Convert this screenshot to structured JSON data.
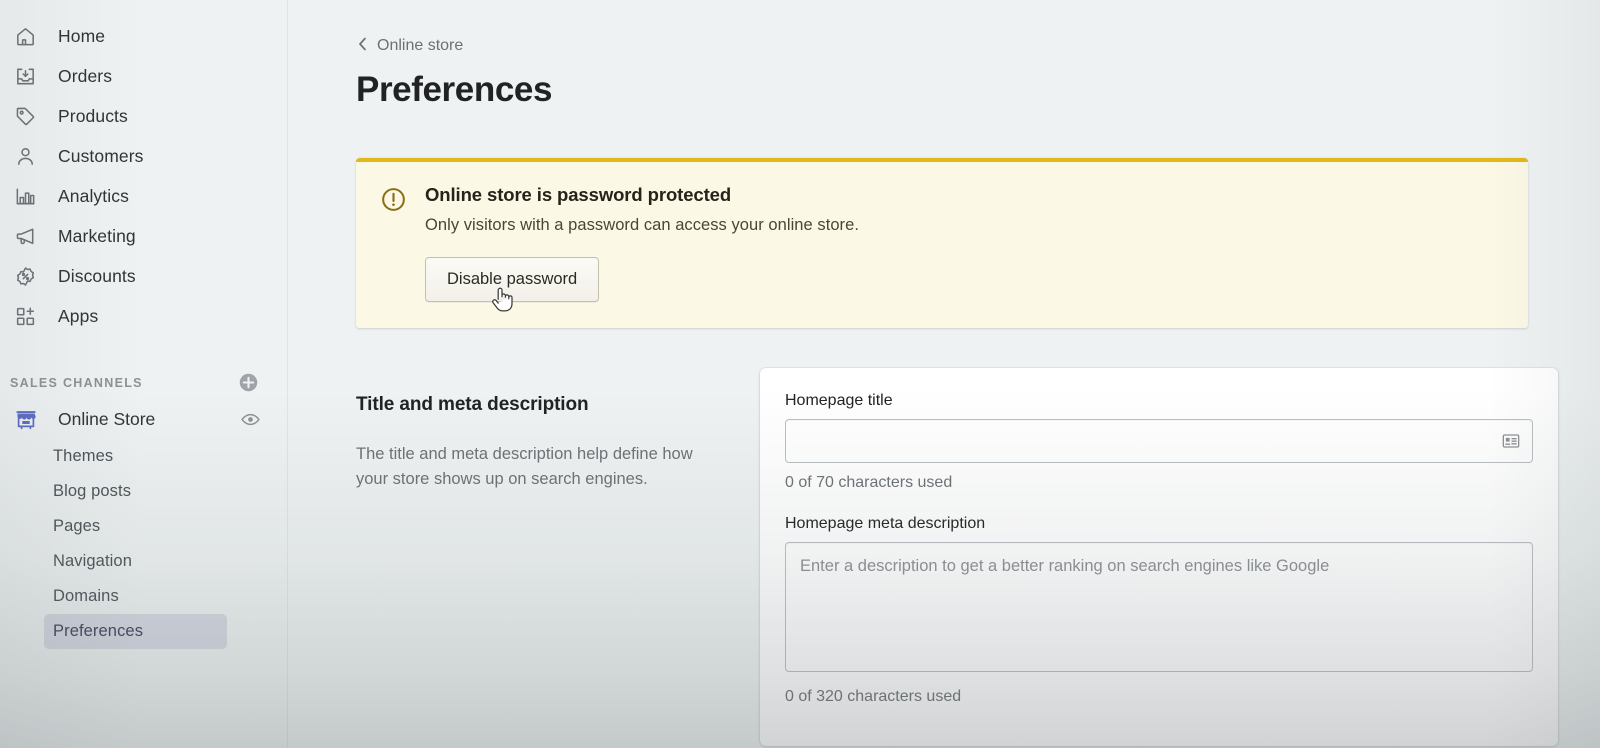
{
  "sidebar": {
    "nav_items": [
      {
        "label": "Home",
        "icon": "home-icon"
      },
      {
        "label": "Orders",
        "icon": "orders-inbox-icon"
      },
      {
        "label": "Products",
        "icon": "product-tag-icon"
      },
      {
        "label": "Customers",
        "icon": "customer-person-icon"
      },
      {
        "label": "Analytics",
        "icon": "analytics-bar-chart-icon"
      },
      {
        "label": "Marketing",
        "icon": "marketing-megaphone-icon"
      },
      {
        "label": "Discounts",
        "icon": "discount-percent-icon"
      },
      {
        "label": "Apps",
        "icon": "apps-grid-plus-icon"
      }
    ],
    "section": {
      "title": "Sales Channels",
      "add_icon": "add-circle-icon"
    },
    "channel": {
      "label": "Online Store",
      "icon": "online-store-icon",
      "view_icon": "eye-icon"
    },
    "sub_items": [
      {
        "label": "Themes",
        "selected": false
      },
      {
        "label": "Blog posts",
        "selected": false
      },
      {
        "label": "Pages",
        "selected": false
      },
      {
        "label": "Navigation",
        "selected": false
      },
      {
        "label": "Domains",
        "selected": false
      },
      {
        "label": "Preferences",
        "selected": true
      }
    ]
  },
  "main": {
    "breadcrumb": {
      "label": "Online store",
      "icon": "chevron-left-icon"
    },
    "page_title": "Preferences",
    "banner": {
      "icon": "alert-circle-icon",
      "title": "Online store is password protected",
      "body": "Only visitors with a password can access your online store.",
      "button_label": "Disable password",
      "accent_color": "#e1b919",
      "background_color": "#fcf8e6"
    },
    "settings": {
      "section_title": "Title and meta description",
      "section_description": "The title and meta description help define how your store shows up on search engines.",
      "homepage_title": {
        "label": "Homepage title",
        "value": "",
        "placeholder": "",
        "helper": "0 of 70 characters used",
        "trailing_icon": "insert-variable-icon"
      },
      "homepage_meta_description": {
        "label": "Homepage meta description",
        "value": "",
        "placeholder": "Enter a description to get a better ranking on search engines like Google",
        "helper": "0 of 320 characters used"
      }
    }
  },
  "cursor": {
    "icon": "pointing-hand-cursor"
  }
}
